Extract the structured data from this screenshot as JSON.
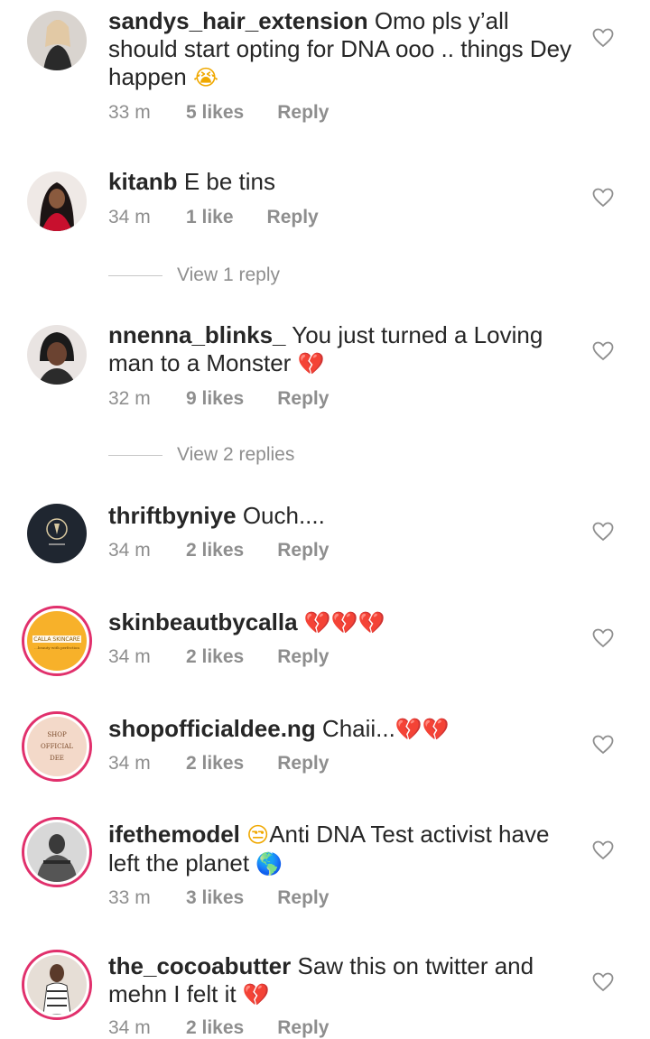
{
  "comments": [
    {
      "username": "sandys_hair_extension",
      "text": "Omo pls y’all should start opting for DNA ooo .. things Dey happen",
      "emoji": "😭",
      "time": "33 m",
      "likes": "5 likes",
      "reply": "Reply"
    },
    {
      "username": "kitanb",
      "text": "E be tins",
      "emoji": "",
      "time": "34 m",
      "likes": "1 like",
      "reply": "Reply",
      "view_replies": "View 1 reply"
    },
    {
      "username": "nnenna_blinks_",
      "text": "You just turned a Loving man to a Monster",
      "emoji": "💔",
      "time": "32 m",
      "likes": "9 likes",
      "reply": "Reply",
      "view_replies": "View 2 replies"
    },
    {
      "username": "thriftbyniye",
      "text": "Ouch....",
      "emoji": "",
      "time": "34 m",
      "likes": "2 likes",
      "reply": "Reply"
    },
    {
      "username": "skinbeautbycalla",
      "text": "",
      "emoji": "💔💔💔",
      "time": "34 m",
      "likes": "2 likes",
      "reply": "Reply"
    },
    {
      "username": "shopofficialdee.ng",
      "text": "Chaii...",
      "emoji": "💔💔",
      "time": "34 m",
      "likes": "2 likes",
      "reply": "Reply"
    },
    {
      "username": "ifethemodel",
      "text": "Anti DNA Test  activist have left the planet",
      "emoji_before": "😒",
      "emoji": "🌎",
      "time": "33 m",
      "likes": "3 likes",
      "reply": "Reply"
    },
    {
      "username": "the_cocoabutter",
      "text": "Saw this on twitter and mehn I felt it",
      "emoji": "💔",
      "time": "34 m",
      "likes": "2 likes",
      "reply": "Reply"
    }
  ],
  "avatar_text": {
    "calla_brand": "CALLA SKINCARE",
    "calla_tagline": "...beauty with perfection",
    "dee_l1": "SHOP",
    "dee_l2": "OFFICIAL",
    "dee_l3": "DEE"
  },
  "icons": {
    "like": "heart-outline-icon"
  },
  "colors": {
    "text": "#262626",
    "meta": "#8e8e8e",
    "story_ring": "#e1306c",
    "heart_stroke": "#8e8e8e",
    "broken_heart": "#e0245e"
  }
}
